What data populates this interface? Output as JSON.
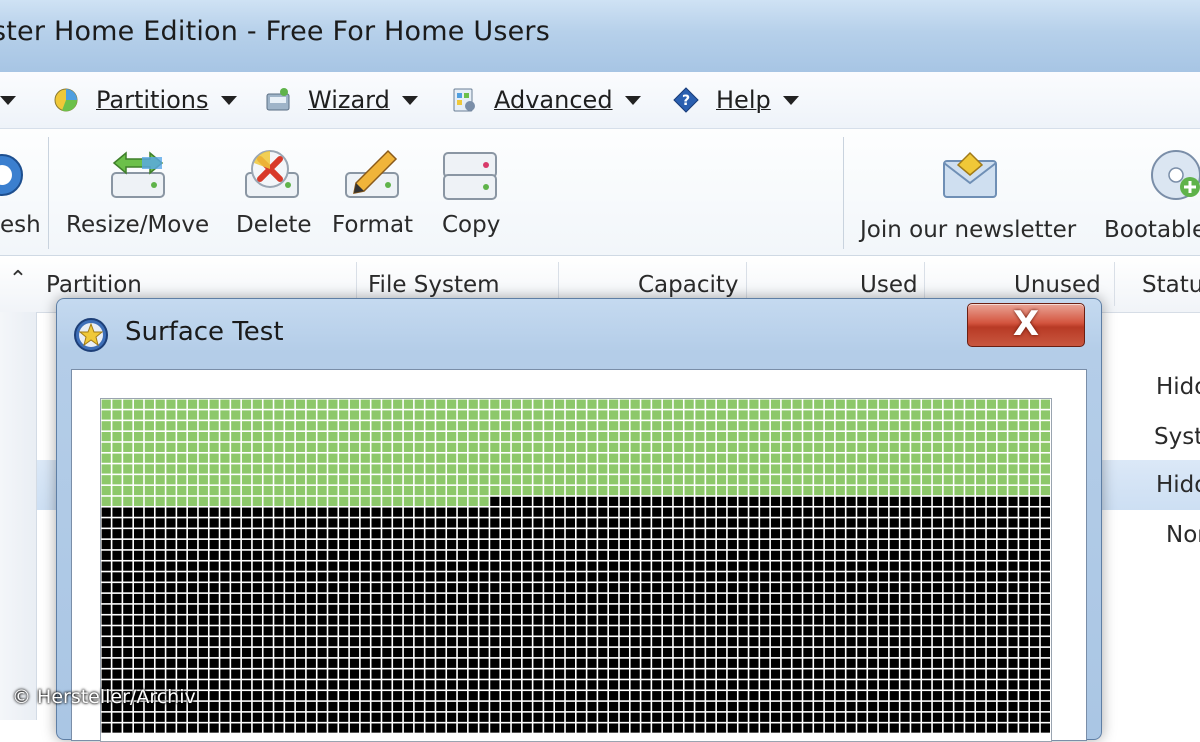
{
  "window": {
    "title": "ster Home Edition - Free For Home Users"
  },
  "menubar": {
    "items": [
      {
        "label": "Partitions",
        "icon": "pie-chart-icon"
      },
      {
        "label": "Wizard",
        "icon": "wizard-icon"
      },
      {
        "label": "Advanced",
        "icon": "advanced-icon"
      },
      {
        "label": "Help",
        "icon": "help-icon"
      }
    ]
  },
  "toolbar": {
    "items": [
      {
        "label": "esh",
        "icon": "refresh-icon"
      },
      {
        "label": "Resize/Move",
        "icon": "resize-move-icon"
      },
      {
        "label": "Delete",
        "icon": "delete-icon"
      },
      {
        "label": "Format",
        "icon": "format-icon"
      },
      {
        "label": "Copy",
        "icon": "copy-icon"
      },
      {
        "label": "Join our newsletter",
        "icon": "envelope-icon"
      },
      {
        "label": "Bootable",
        "icon": "bootable-cd-icon"
      }
    ]
  },
  "table": {
    "collapse_glyph": "⌃",
    "columns": [
      "Partition",
      "File System",
      "Capacity",
      "Used",
      "Unused",
      "Statu"
    ],
    "status_values": [
      "Hido",
      "Syst",
      "Hido",
      "Nor"
    ]
  },
  "dialog": {
    "title": "Surface Test",
    "close_glyph": "X",
    "surface": {
      "columns": 88,
      "rows": 31,
      "good_color": "#8dc86a",
      "pending_color": "#000000",
      "full_good_rows": 9,
      "partial_row_good_cells": 36
    }
  },
  "watermark": "© Hersteller/Archiv",
  "colors": {
    "titlebar": "#b6d0ea",
    "close_button": "#d4553f",
    "selected_row": "#cddff3"
  }
}
